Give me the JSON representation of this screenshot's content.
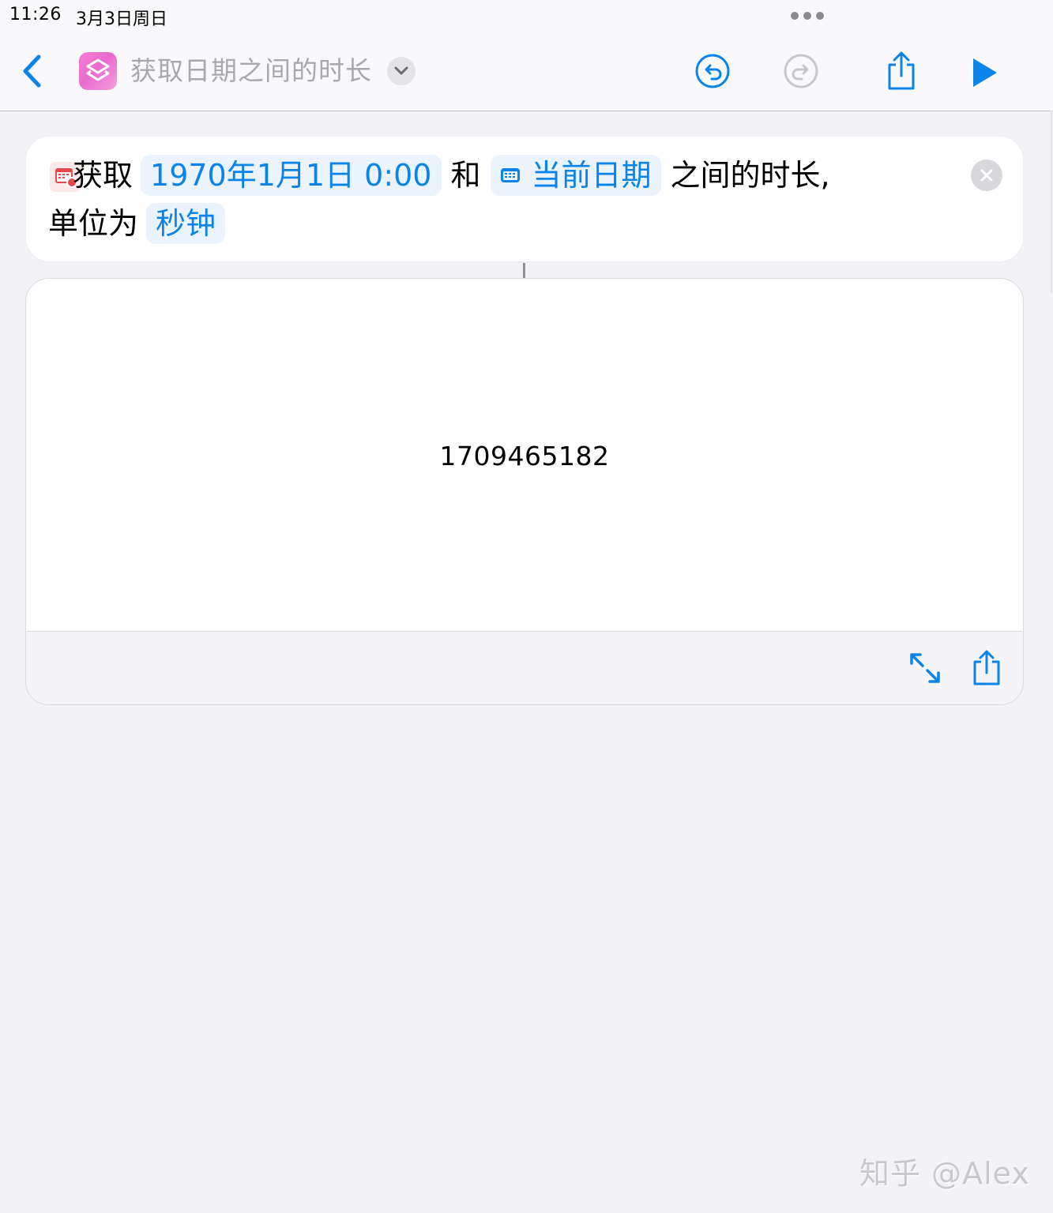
{
  "status_bar": {
    "time": "11:26",
    "date": "3月3日周日"
  },
  "nav": {
    "title": "获取日期之间的时长",
    "app_icon": "shortcuts-icon",
    "buttons": [
      "back-icon",
      "chevron-down-icon",
      "undo-icon",
      "redo-icon",
      "share-icon",
      "play-icon"
    ]
  },
  "action": {
    "icon": "calendar-icon",
    "verb": "获取",
    "start_date": "1970年1月1日 0:00",
    "conjunction": "和",
    "end_date_icon": "calendar-small-icon",
    "end_date": "当前日期",
    "suffix": "之间的时长,",
    "unit_label": "单位为",
    "unit": "秒钟"
  },
  "result": {
    "value": "1709465182",
    "footer_buttons": [
      "expand-icon",
      "share-icon"
    ]
  },
  "watermark": "知乎 @Alex",
  "colors": {
    "accent": "#0a84e8",
    "token_bg": "#eaf3fe",
    "background": "#f2f2f7",
    "title_gray": "#a9a9ad",
    "calendar_red": "#e5484d"
  }
}
